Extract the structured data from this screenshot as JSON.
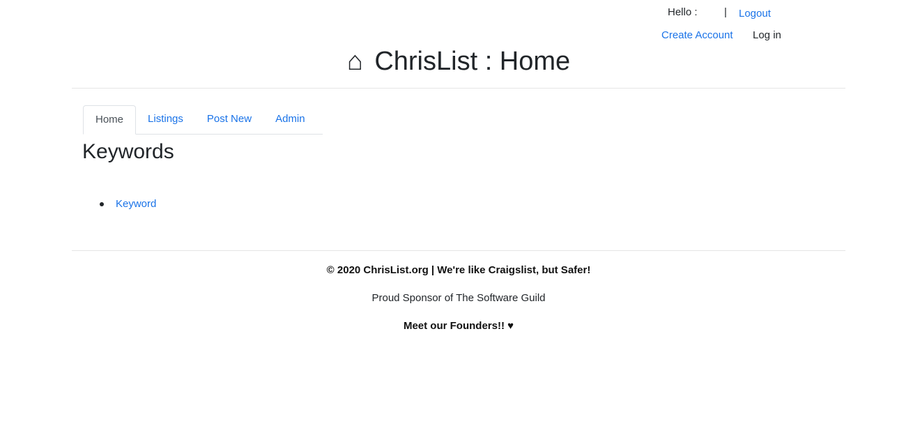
{
  "header": {
    "hello_label": "Hello :",
    "separator": "|",
    "logout_label": "Logout",
    "create_account_label": "Create Account",
    "login_label": "Log in"
  },
  "title": {
    "icon": "⌂",
    "text": "ChrisList : Home"
  },
  "tabs": [
    {
      "label": "Home",
      "active": true
    },
    {
      "label": "Listings",
      "active": false
    },
    {
      "label": "Post New",
      "active": false
    },
    {
      "label": "Admin",
      "active": false
    }
  ],
  "main": {
    "section_title": "Keywords",
    "keywords": [
      "Keyword"
    ]
  },
  "footer": {
    "copyright": "© 2020 ChrisList.org | We're like Craigslist, but Safer!",
    "sponsor": "Proud Sponsor of The Software Guild",
    "founders": "Meet our Founders!! ♥"
  },
  "colors": {
    "link": "#1a73e8",
    "text": "#212529",
    "divider": "#e5e5e5"
  }
}
